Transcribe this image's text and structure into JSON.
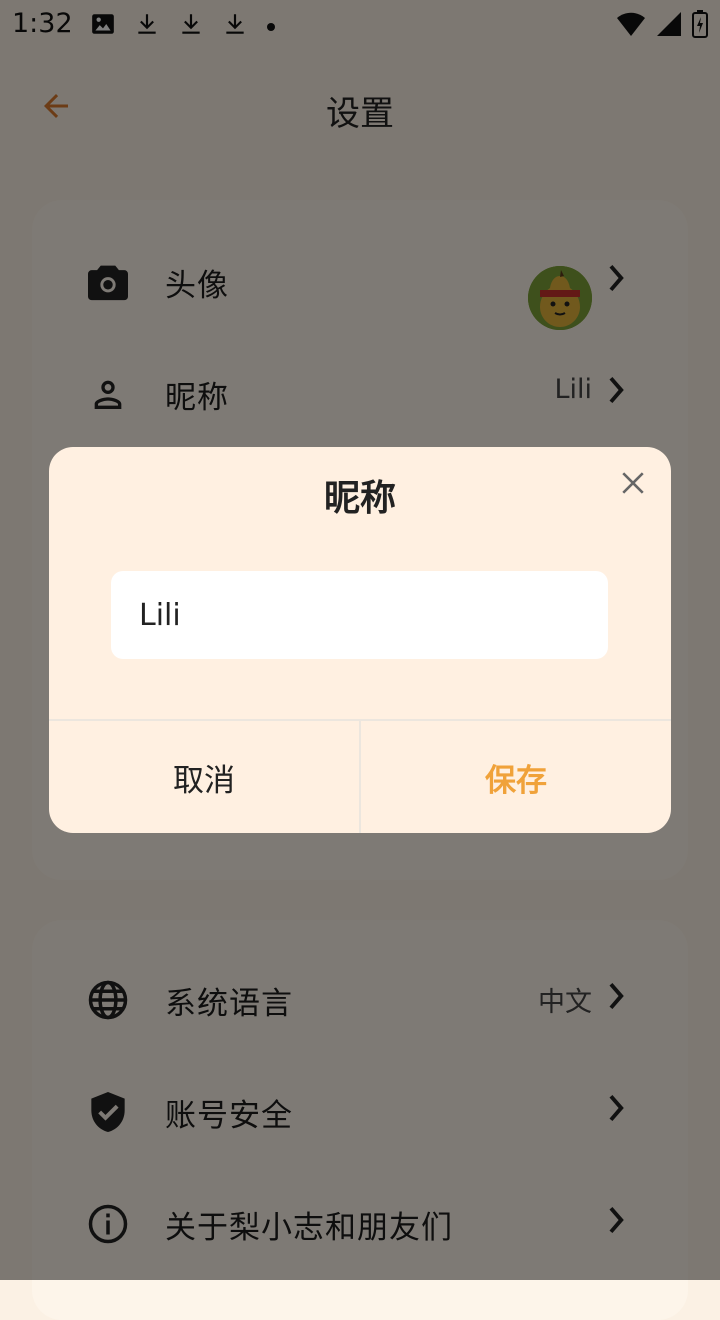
{
  "status_bar": {
    "time": "1:32"
  },
  "app_bar": {
    "title": "设置"
  },
  "card1": {
    "rows": [
      {
        "label": "头像",
        "value": "",
        "icon": "camera-icon"
      },
      {
        "label": "昵称",
        "value": "Lili",
        "icon": "person-icon"
      }
    ]
  },
  "card2": {
    "rows": [
      {
        "label": "系统语言",
        "value": "中文",
        "icon": "globe-icon"
      },
      {
        "label": "账号安全",
        "value": "",
        "icon": "shield-check-icon"
      },
      {
        "label": "关于梨小志和朋友们",
        "value": "",
        "icon": "info-icon"
      }
    ]
  },
  "dialog": {
    "title": "昵称",
    "input_value": "Lili",
    "cancel_label": "取消",
    "save_label": "保存"
  },
  "colors": {
    "accent": "#f0a23a",
    "back_arrow": "#d8792c",
    "dialog_bg": "#fff0e1",
    "scrim": "rgba(0,0,0,0.5)"
  }
}
